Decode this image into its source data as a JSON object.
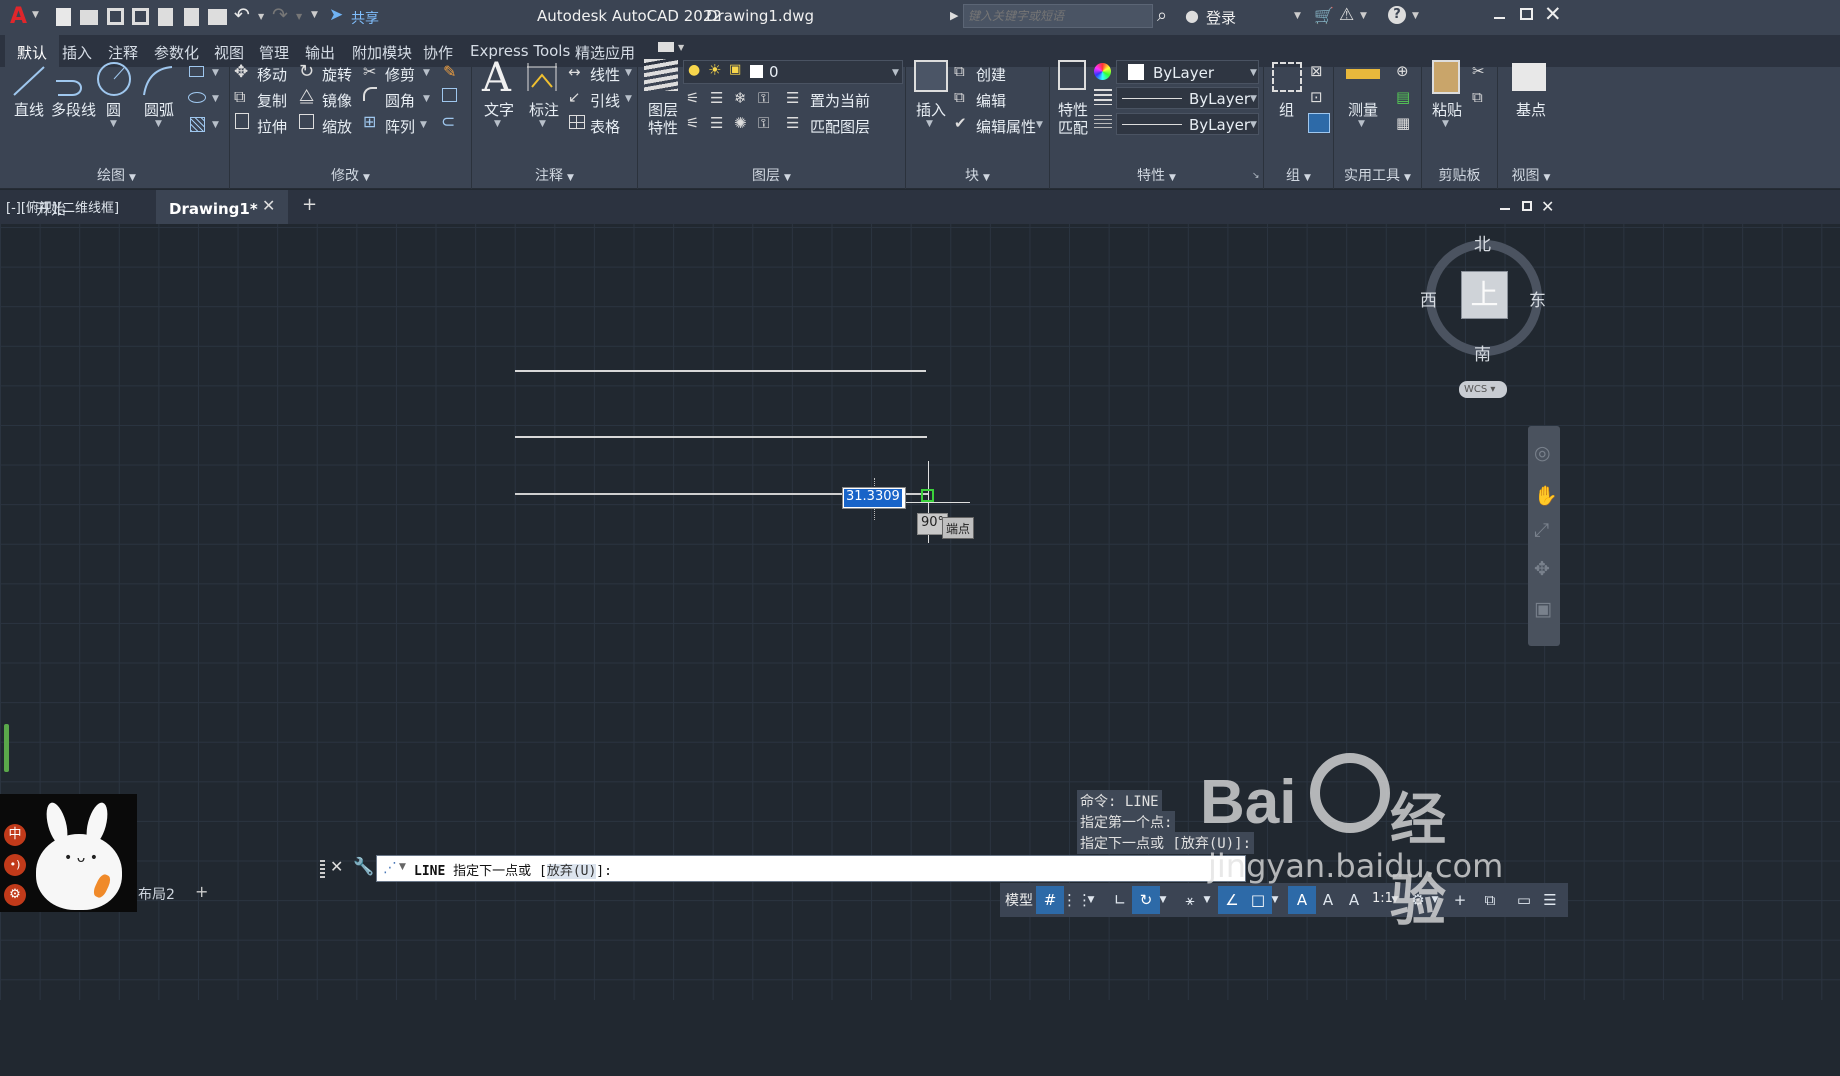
{
  "app": {
    "title": "Autodesk AutoCAD 2022",
    "file": "Drawing1.dwg",
    "share": "共享",
    "search_placeholder": "键入关键字或短语",
    "login": "登录"
  },
  "ribbon_tabs": [
    "默认",
    "插入",
    "注释",
    "参数化",
    "视图",
    "管理",
    "输出",
    "附加模块",
    "协作",
    "Express Tools",
    "精选应用"
  ],
  "draw": {
    "title": "绘图",
    "line": "直线",
    "polyline": "多段线",
    "circle": "圆",
    "arc": "圆弧"
  },
  "modify": {
    "title": "修改",
    "move": "移动",
    "rotate": "旋转",
    "trim": "修剪",
    "copy": "复制",
    "mirror": "镜像",
    "fillet": "圆角",
    "stretch": "拉伸",
    "scale": "缩放",
    "array": "阵列"
  },
  "annotation": {
    "title": "注释",
    "text": "文字",
    "dimension": "标注",
    "linear": "线性",
    "leader": "引线",
    "table": "表格"
  },
  "layers": {
    "title": "图层",
    "props_a": "图层",
    "props_b": "特性",
    "current_layer": "0",
    "make_current": "置为当前",
    "match_layer": "匹配图层"
  },
  "block": {
    "title": "块",
    "insert": "插入",
    "create": "创建",
    "edit": "编辑",
    "edit_attr": "编辑属性"
  },
  "properties": {
    "title": "特性",
    "match_a": "特性",
    "match_b": "匹配",
    "color": "ByLayer",
    "linetype": "ByLayer",
    "lineweight": "ByLayer"
  },
  "groups": {
    "title": "组",
    "group": "组"
  },
  "utilities": {
    "title": "实用工具",
    "measure": "测量"
  },
  "clipboard": {
    "title": "剪贴板",
    "paste": "粘贴"
  },
  "view": {
    "title": "视图",
    "base": "基点"
  },
  "doc_tabs": {
    "start": "开始",
    "drawing": "Drawing1*",
    "add": "+"
  },
  "viewport": {
    "label": "[-][俯视][二维线框]"
  },
  "viewcube": {
    "north": "北",
    "south": "南",
    "east": "东",
    "west": "西",
    "top": "上",
    "wcs": "WCS"
  },
  "dynamic_input": {
    "length": "31.3309",
    "angle": "90°",
    "snap": "端点"
  },
  "command_history": [
    "命令: LINE",
    "指定第一个点:",
    "指定下一点或 [放弃(U)]:"
  ],
  "command_line": {
    "cmd": "LINE",
    "prompt": "指定下一点或",
    "option": "放弃(U)",
    "tail": "]:",
    "open": "["
  },
  "layout": {
    "tab": "布局2",
    "add": "+"
  },
  "status": {
    "model": "模型",
    "scale": "1:1"
  },
  "watermark": {
    "brand": "Bai",
    "brand2": "经验",
    "url": "jingyan.baidu.com"
  },
  "ime": {
    "chinese": "中"
  }
}
